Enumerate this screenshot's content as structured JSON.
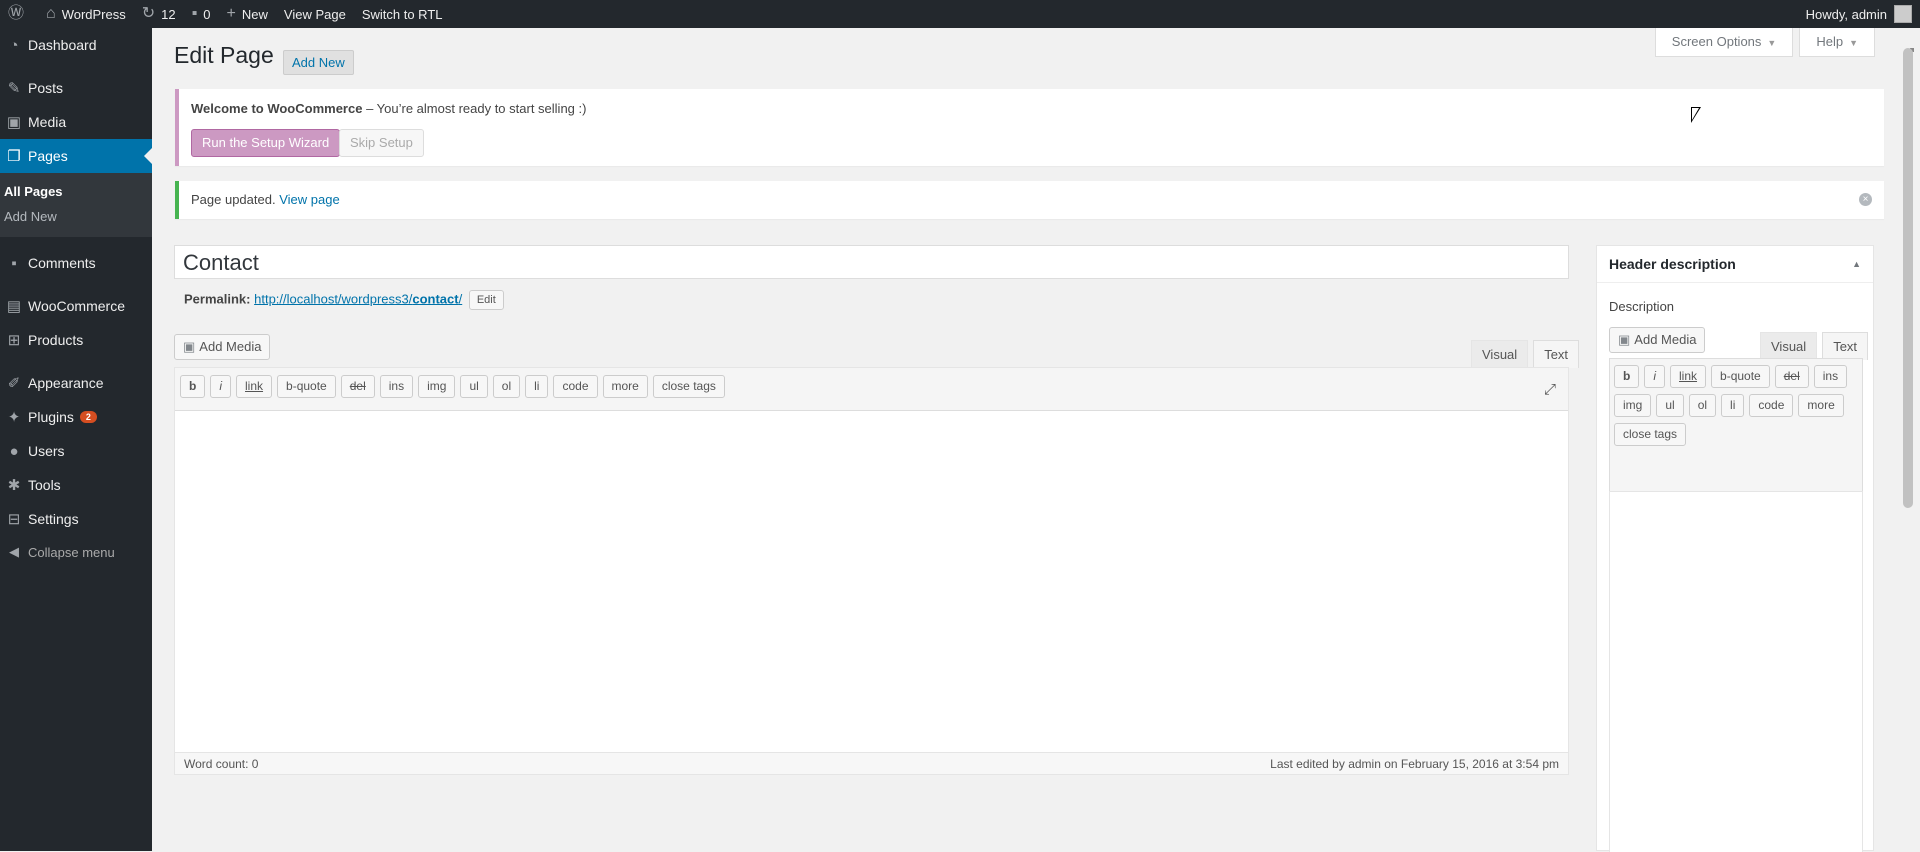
{
  "adminbar": {
    "site_name": "WordPress",
    "updates_count": "12",
    "comments_count": "0",
    "new_label": "New",
    "view_page": "View Page",
    "switch_rtl": "Switch to RTL",
    "howdy": "Howdy, admin"
  },
  "menu": {
    "dashboard": "Dashboard",
    "posts": "Posts",
    "media": "Media",
    "pages": "Pages",
    "all_pages": "All Pages",
    "add_new": "Add New",
    "comments": "Comments",
    "woocommerce": "WooCommerce",
    "products": "Products",
    "appearance": "Appearance",
    "plugins": "Plugins",
    "plugins_badge": "2",
    "users": "Users",
    "tools": "Tools",
    "settings": "Settings",
    "collapse": "Collapse menu"
  },
  "screen_meta": {
    "screen_options": "Screen Options",
    "help": "Help"
  },
  "page": {
    "heading": "Edit Page",
    "add_new": "Add New"
  },
  "woo_notice": {
    "title": "Welcome to WooCommerce",
    "message": " – You’re almost ready to start selling :)",
    "run_wizard": "Run the Setup Wizard",
    "skip": "Skip Setup"
  },
  "update_notice": {
    "text": "Page updated.",
    "link": "View page"
  },
  "post": {
    "title": "Contact",
    "permalink_label": "Permalink:",
    "permalink_base": "http://localhost/wordpress3/",
    "permalink_slug": "contact",
    "permalink_end": "/",
    "edit": "Edit"
  },
  "editor": {
    "add_media": "Add Media",
    "tab_visual": "Visual",
    "tab_text": "Text",
    "quicktags": [
      "b",
      "i",
      "link",
      "b-quote",
      "del",
      "ins",
      "img",
      "ul",
      "ol",
      "li",
      "code",
      "more",
      "close tags"
    ],
    "word_count": "Word count: 0",
    "last_edited": "Last edited by admin on February 15, 2016 at 3:54 pm"
  },
  "sidebox": {
    "title": "Header description",
    "label": "Description",
    "add_media": "Add Media",
    "tab_visual": "Visual",
    "tab_text": "Text",
    "quicktags": [
      "b",
      "i",
      "link",
      "b-quote",
      "del",
      "ins",
      "img",
      "ul",
      "ol",
      "li",
      "code",
      "more",
      "close tags"
    ]
  },
  "colors": {
    "accent": "#0073aa",
    "sidebar": "#23282d",
    "woo": "#cc99c2",
    "success": "#46b450"
  }
}
